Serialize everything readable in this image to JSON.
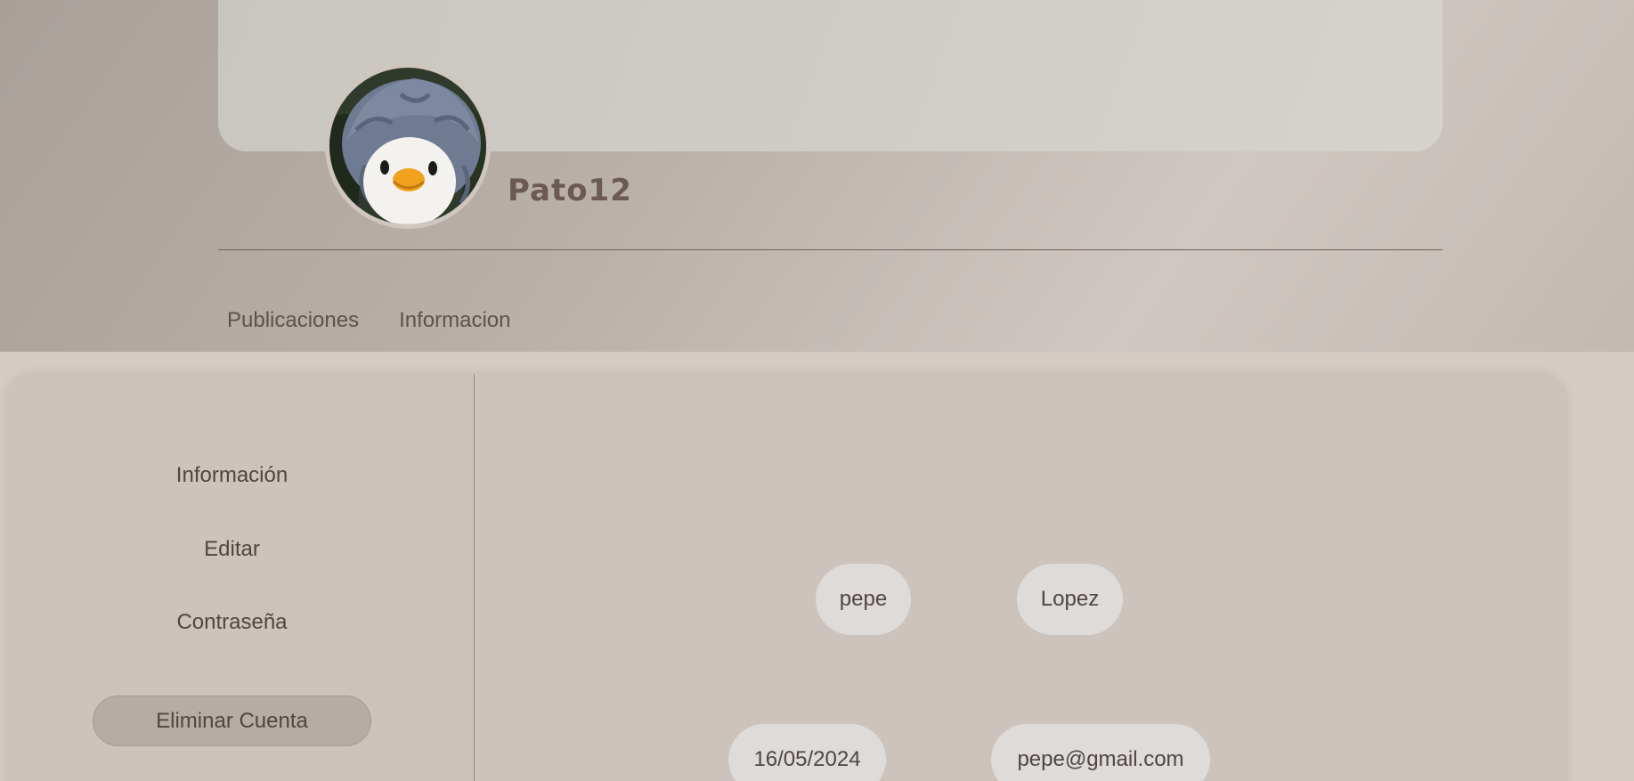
{
  "profile": {
    "username": "Pato12",
    "tabs": [
      "Publicaciones",
      "Informacion"
    ]
  },
  "sidebar": {
    "items": [
      "Información",
      "Editar",
      "Contraseña"
    ],
    "delete_label": "Eliminar Cuenta"
  },
  "info": {
    "first_name": "pepe",
    "last_name": "Lopez",
    "date": "16/05/2024",
    "email": "pepe@gmail.com"
  },
  "colors": {
    "page_background": "#d3cbc4",
    "panel_background": "#cbc3bc",
    "pill_background": "#dedbd9",
    "delete_button": "#b5ada4",
    "username_text": "#6a5a53"
  }
}
